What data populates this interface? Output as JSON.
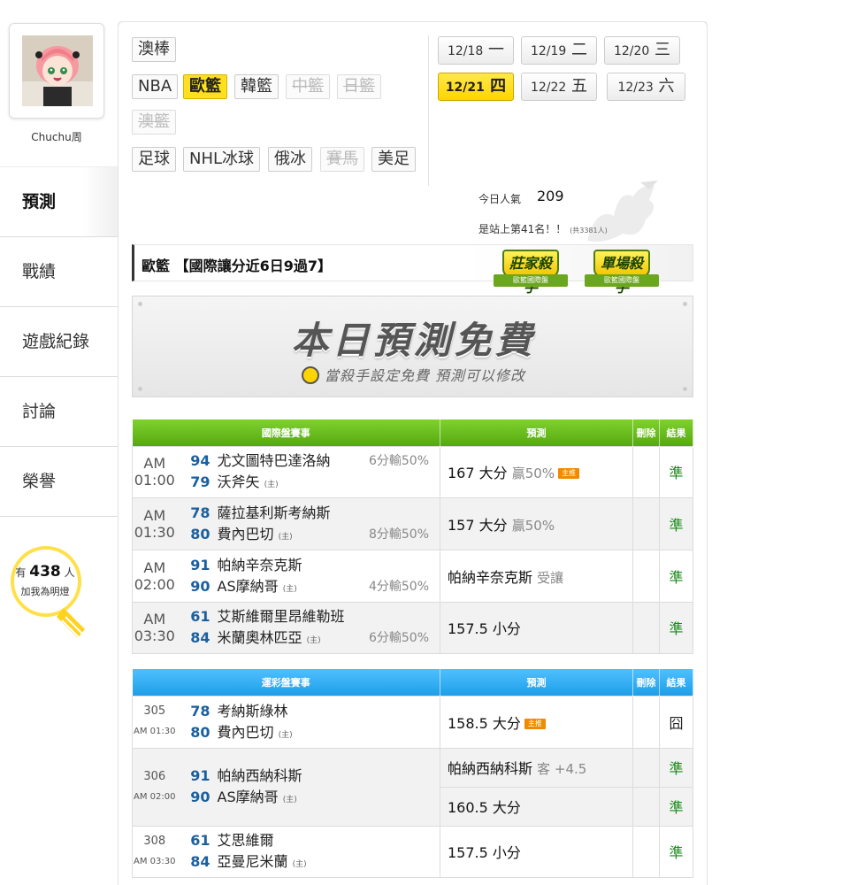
{
  "user": {
    "name": "Chuchu周"
  },
  "nav": [
    "預測",
    "戰績",
    "遊戲紀錄",
    "討論",
    "榮譽"
  ],
  "fans": {
    "prefix": "有",
    "count": "438",
    "suffix": "人",
    "cta": "加我為明燈"
  },
  "sports": {
    "row1": [
      "澳棒"
    ],
    "row2": [
      "NBA",
      "歐籃",
      "韓籃",
      "中籃",
      "日籃"
    ],
    "row3": [
      "澳籃"
    ],
    "row4": [
      "足球",
      "NHL冰球",
      "俄冰",
      "賽馬",
      "美足"
    ],
    "selected": "歐籃",
    "disabled": [
      "中籃",
      "日籃",
      "澳籃",
      "賽馬"
    ]
  },
  "dates": [
    {
      "md": "12/18",
      "wd": "一"
    },
    {
      "md": "12/19",
      "wd": "二"
    },
    {
      "md": "12/20",
      "wd": "三"
    },
    {
      "md": "12/21",
      "wd": "四"
    },
    {
      "md": "12/22",
      "wd": "五"
    },
    {
      "md": "12/23",
      "wd": "六"
    }
  ],
  "selected_date": "12/21",
  "popularity": {
    "label": "今日人氣",
    "value": "209",
    "rank": "是站上第41名！！",
    "rank_note": "(共3381人)"
  },
  "section_title": "歐籃 【國際讓分近6日9過7】",
  "badges": [
    {
      "title": "莊家殺手",
      "ribbon": "歐籃國際盤"
    },
    {
      "title": "單場殺手",
      "ribbon": "歐籃國際盤"
    }
  ],
  "banner": {
    "main": "本日預測免費",
    "sub": "當殺手設定免費 預測可以修改"
  },
  "intl_table": {
    "headers": [
      "國際盤賽事",
      "預測",
      "刪除",
      "結果"
    ],
    "main_tag": "主推",
    "rows": [
      {
        "time": "AM 01:00",
        "top_score": "94",
        "top_team": "尤文圖特巴達洛納",
        "top_spread": "6分輸50%",
        "bot_score": "79",
        "bot_team": "沃斧矢",
        "bot_home": "(主)",
        "bot_spread": "",
        "pred": "167 大分",
        "pred_sub": "贏50%",
        "main": true,
        "result": "準"
      },
      {
        "time": "AM 01:30",
        "top_score": "78",
        "top_team": "薩拉基利斯考納斯",
        "top_spread": "",
        "bot_score": "80",
        "bot_team": "費內巴切",
        "bot_home": "(主)",
        "bot_spread": "8分輸50%",
        "pred": "157 大分",
        "pred_sub": "贏50%",
        "main": false,
        "result": "準"
      },
      {
        "time": "AM 02:00",
        "top_score": "91",
        "top_team": "帕納辛奈克斯",
        "top_spread": "",
        "bot_score": "90",
        "bot_team": "AS摩納哥",
        "bot_home": "(主)",
        "bot_spread": "4分輸50%",
        "pred": "帕納辛奈克斯",
        "pred_sub": "受讓",
        "main": false,
        "result": "準"
      },
      {
        "time": "AM 03:30",
        "top_score": "61",
        "top_team": "艾斯維爾里昂維勒班",
        "top_spread": "",
        "bot_score": "84",
        "bot_team": "米蘭奧林匹亞",
        "bot_home": "(主)",
        "bot_spread": "6分輸50%",
        "pred": "157.5 小分",
        "pred_sub": "",
        "main": false,
        "result": "準"
      }
    ]
  },
  "lottery_table": {
    "headers": [
      "運彩盤賽事",
      "預測",
      "刪除",
      "結果"
    ],
    "main_tag": "主推",
    "rows": [
      {
        "num": "305",
        "time": "AM 01:30",
        "top_score": "78",
        "top_team": "考納斯綠林",
        "bot_score": "80",
        "bot_team": "費內巴切",
        "bot_home": "(主)",
        "preds": [
          {
            "main": "158.5 大分",
            "sub": "",
            "tag": true,
            "result": "囧"
          }
        ]
      },
      {
        "num": "306",
        "time": "AM 02:00",
        "top_score": "91",
        "top_team": "帕納西納科斯",
        "bot_score": "90",
        "bot_team": "AS摩納哥",
        "bot_home": "(主)",
        "preds": [
          {
            "main": "帕納西納科斯",
            "sub": "客 +4.5",
            "tag": false,
            "result": "準"
          },
          {
            "main": "160.5 大分",
            "sub": "",
            "tag": false,
            "result": "準"
          }
        ]
      },
      {
        "num": "308",
        "time": "AM 03:30",
        "top_score": "61",
        "top_team": "艾思維爾",
        "bot_score": "84",
        "bot_team": "亞曼尼米蘭",
        "bot_home": "(主)",
        "preds": [
          {
            "main": "157.5 小分",
            "sub": "",
            "tag": false,
            "result": "準"
          }
        ]
      }
    ]
  }
}
